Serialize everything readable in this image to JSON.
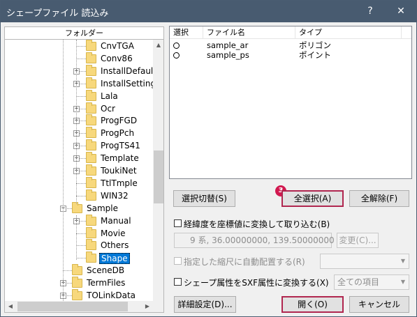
{
  "window": {
    "title": "シェープファイル 読込み",
    "help_glyph": "?",
    "close_glyph": "✕"
  },
  "folder_pane": {
    "header": "フォルダー",
    "items": [
      {
        "label": "CnvTGA",
        "expandable": false
      },
      {
        "label": "Conv86",
        "expandable": false
      },
      {
        "label": "InstallDefault",
        "expandable": true
      },
      {
        "label": "InstallSetting",
        "expandable": true
      },
      {
        "label": "Lala",
        "expandable": false
      },
      {
        "label": "Ocr",
        "expandable": true
      },
      {
        "label": "ProgFGD",
        "expandable": true
      },
      {
        "label": "ProgPch",
        "expandable": true
      },
      {
        "label": "ProgTS41",
        "expandable": true
      },
      {
        "label": "Template",
        "expandable": true
      },
      {
        "label": "ToukiNet",
        "expandable": true
      },
      {
        "label": "TtlTmple",
        "expandable": false
      },
      {
        "label": "WIN32",
        "expandable": false
      },
      {
        "label": "Sample",
        "expandable": true,
        "expanded": true
      },
      {
        "label": "Manual",
        "expandable": true
      },
      {
        "label": "Movie",
        "expandable": false
      },
      {
        "label": "Others",
        "expandable": false
      },
      {
        "label": "Shape",
        "expandable": false,
        "selected": true
      },
      {
        "label": "SceneDB",
        "expandable": false
      },
      {
        "label": "TermFiles",
        "expandable": true
      },
      {
        "label": "TOLinkData",
        "expandable": true
      }
    ],
    "expand_glyph": "+",
    "collapse_glyph": "−"
  },
  "file_list": {
    "columns": [
      "選択",
      "ファイル名",
      "タイプ"
    ],
    "rows": [
      {
        "name": "sample_ar",
        "type": "ポリゴン"
      },
      {
        "name": "sample_ps",
        "type": "ポイント"
      }
    ]
  },
  "buttons": {
    "toggle_selection": "選択切替(S)",
    "select_all": "全選択(A)",
    "deselect_all": "全解除(F)",
    "change": "変更(C)...",
    "detail_settings": "詳細設定(D)...",
    "open": "開く(O)",
    "cancel": "キャンセル"
  },
  "step_badge": "3",
  "options": {
    "convert_latlon": "経緯度を座標値に変換して取り込む(B)",
    "coord_value": "9 系, 36.00000000, 139.50000000",
    "auto_place": "指定した縮尺に自動配置する(R)",
    "sxf_convert": "シェープ属性をSXF属性に変換する(X)",
    "all_items": "全ての項目"
  },
  "scroll_glyphs": {
    "up": "▲",
    "down": "▼",
    "left": "◀",
    "right": "▶"
  },
  "colors": {
    "titlebar": "#485b70",
    "highlight_border": "#b0264f",
    "badge": "#d1184f",
    "selection": "#0078d7"
  }
}
